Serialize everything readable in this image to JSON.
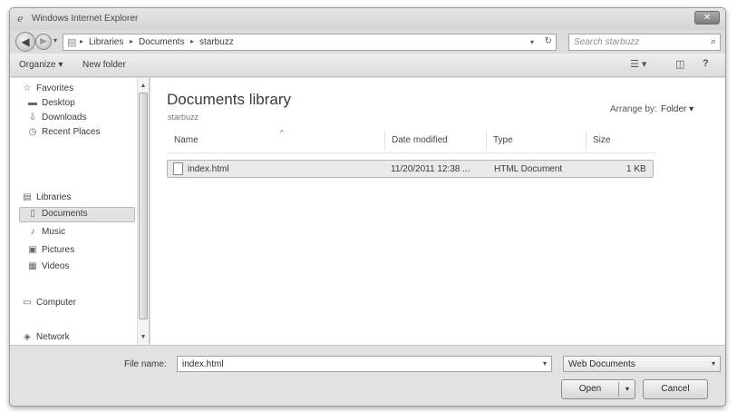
{
  "window": {
    "title": "Windows Internet Explorer",
    "close_glyph": "✕"
  },
  "nav": {
    "back_glyph": "◀",
    "forward_glyph": "▶",
    "dropdown_glyph": "▾"
  },
  "address": {
    "breadcrumbs": [
      "Libraries",
      "Documents",
      "starbuzz"
    ],
    "separator": "▸",
    "dropdown_glyph": "▾",
    "refresh_glyph": "↻"
  },
  "search": {
    "placeholder": "Search starbuzz",
    "icon_glyph": "⌕"
  },
  "toolbar": {
    "organize_label": "Organize ▾",
    "new_folder_label": "New folder",
    "views_glyph": "☰ ▾",
    "preview_glyph": "◫",
    "help_glyph": "?"
  },
  "sidebar": {
    "favorites": {
      "label": "Favorites",
      "icon": "☆"
    },
    "favorite_items": [
      {
        "label": "Desktop",
        "icon": "▬"
      },
      {
        "label": "Downloads",
        "icon": "⇩"
      },
      {
        "label": "Recent Places",
        "icon": "◷"
      }
    ],
    "libraries": {
      "label": "Libraries",
      "icon": "▤"
    },
    "library_items": [
      {
        "label": "Documents",
        "icon": "▯"
      },
      {
        "label": "Music",
        "icon": "♪"
      },
      {
        "label": "Pictures",
        "icon": "▣"
      },
      {
        "label": "Videos",
        "icon": "▦"
      }
    ],
    "computer": {
      "label": "Computer",
      "icon": "▭"
    },
    "network": {
      "label": "Network",
      "icon": "◈"
    },
    "selected": "Documents",
    "scroll_up": "▲",
    "scroll_down": "▼"
  },
  "main": {
    "library_title": "Documents library",
    "library_subtitle": "starbuzz",
    "arrange_label": "Arrange by:",
    "arrange_value": "Folder ▾",
    "sort_glyph": "^",
    "columns": [
      "Name",
      "Date modified",
      "Type",
      "Size"
    ],
    "files": [
      {
        "name": "index.html",
        "date_modified": "11/20/2011 12:38 ...",
        "type": "HTML Document",
        "size": "1 KB"
      }
    ]
  },
  "dialog": {
    "file_name_label": "File name:",
    "file_name_value": "index.html",
    "file_type_value": "Web Documents",
    "dropdown_glyph": "▾",
    "open_label": "Open",
    "open_arrow": "▾",
    "cancel_label": "Cancel"
  }
}
